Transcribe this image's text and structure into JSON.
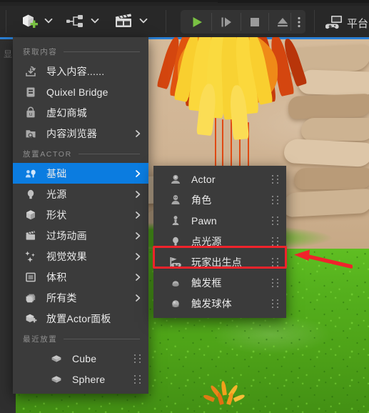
{
  "app": {
    "title": "Unreal Editor viewport with Place Actors quick-add menu"
  },
  "toolbar": {
    "buttons": [
      {
        "name": "add-actor-dropdown",
        "icon": "cube-plus-icon",
        "label": ""
      },
      {
        "name": "blueprints-dropdown",
        "icon": "blueprint-node-icon",
        "label": ""
      },
      {
        "name": "cinematics-dropdown",
        "icon": "clapperboard-icon",
        "label": ""
      }
    ],
    "play_controls": [
      {
        "name": "play-button",
        "icon": "play-icon",
        "label": ""
      },
      {
        "name": "step-frame-button",
        "icon": "frame-advance-icon",
        "label": ""
      },
      {
        "name": "stop-button",
        "icon": "stop-square-icon",
        "label": ""
      },
      {
        "name": "eject-button",
        "icon": "eject-icon",
        "label": ""
      },
      {
        "name": "play-options-button",
        "icon": "kebab-menu-icon",
        "label": ""
      }
    ],
    "platforms": {
      "icon": "gamepad-screen-icon",
      "label": "平台"
    }
  },
  "viewport": {
    "side_glyph": "显"
  },
  "menu": {
    "sections": [
      {
        "header": "获取内容",
        "items": [
          {
            "label": "导入内容......",
            "icon": "import-icon",
            "submenu": false,
            "selected": false
          },
          {
            "label": "Quixel Bridge",
            "icon": "bridge-icon",
            "submenu": false,
            "selected": false
          },
          {
            "label": "虚幻商城",
            "icon": "marketplace-bag-icon",
            "submenu": false,
            "selected": false
          },
          {
            "label": "内容浏览器",
            "icon": "folder-search-icon",
            "submenu": true,
            "selected": false
          }
        ]
      },
      {
        "header": "放置ACTOR",
        "items": [
          {
            "label": "基础",
            "icon": "basic-actors-icon",
            "submenu": true,
            "selected": true
          },
          {
            "label": "光源",
            "icon": "light-bulb-icon",
            "submenu": true,
            "selected": false
          },
          {
            "label": "形状",
            "icon": "shape-cube-icon",
            "submenu": true,
            "selected": false
          },
          {
            "label": "过场动画",
            "icon": "clapperboard-icon",
            "submenu": true,
            "selected": false
          },
          {
            "label": "视觉效果",
            "icon": "sparkle-vfx-icon",
            "submenu": true,
            "selected": false
          },
          {
            "label": "体积",
            "icon": "volume-box-icon",
            "submenu": true,
            "selected": false
          },
          {
            "label": "所有类",
            "icon": "all-classes-icon",
            "submenu": true,
            "selected": false
          },
          {
            "label": "放置Actor面板",
            "icon": "place-actor-panel-icon",
            "submenu": false,
            "selected": false
          }
        ]
      },
      {
        "header": "最近放置",
        "items": [
          {
            "label": "Cube",
            "icon": "cube-icon",
            "grip": true,
            "selected": false
          },
          {
            "label": "Sphere",
            "icon": "cube-icon",
            "grip": true,
            "selected": false
          }
        ]
      }
    ]
  },
  "submenu": {
    "items": [
      {
        "label": "Actor",
        "icon": "actor-icon",
        "grip": true,
        "highlighted": false
      },
      {
        "label": "角色",
        "icon": "character-icon",
        "grip": true,
        "highlighted": false
      },
      {
        "label": "Pawn",
        "icon": "pawn-icon",
        "grip": true,
        "highlighted": false
      },
      {
        "label": "点光源",
        "icon": "point-light-icon",
        "grip": true,
        "highlighted": false
      },
      {
        "label": "玩家出生点",
        "icon": "player-start-flag-icon",
        "grip": true,
        "highlighted": true
      },
      {
        "label": "触发框",
        "icon": "trigger-box-icon",
        "grip": true,
        "highlighted": false
      },
      {
        "label": "触发球体",
        "icon": "trigger-sphere-icon",
        "grip": true,
        "highlighted": false
      }
    ]
  },
  "annotation": {
    "highlight_color": "#f0232b",
    "arrow_color": "#f0232b",
    "target_label": "玩家出生点"
  },
  "colors": {
    "menu_background": "#3b3b3b",
    "selection_blue": "#0b7ce0",
    "toolbar_background": "#282828",
    "play_green": "#7ac143",
    "viewport_accent": "#2a7fd4"
  }
}
